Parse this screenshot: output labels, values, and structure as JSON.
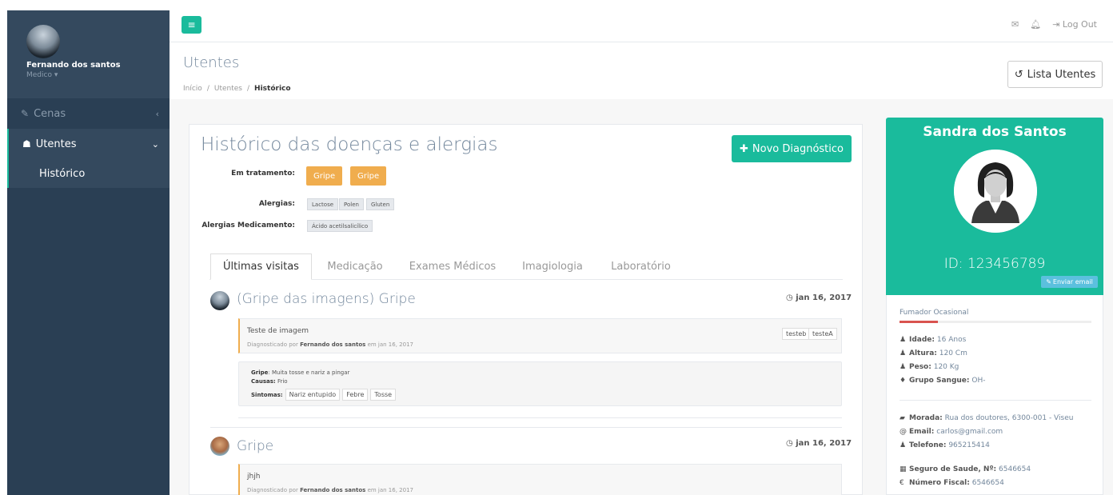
{
  "sidebar": {
    "user_name": "Fernando dos santos",
    "user_role": "Medico",
    "items": [
      {
        "label": "Cenas",
        "icon": "edit-icon"
      },
      {
        "label": "Utentes",
        "icon": "users-icon"
      }
    ],
    "sub_items": [
      {
        "label": "Histórico"
      }
    ]
  },
  "topbar": {
    "menu_icon": "≡",
    "logout_label": "Log Out"
  },
  "header": {
    "title": "Utentes",
    "breadcrumb": [
      "Início",
      "Utentes",
      "Histórico"
    ],
    "lista_button": "Lista Utentes"
  },
  "history": {
    "title": "Histórico das doenças e alergias",
    "novo_button": "Novo Diagnóstico",
    "em_tratamento_label": "Em tratamento:",
    "em_tratamento": [
      "Gripe",
      "Gripe"
    ],
    "alergias_label": "Alergias:",
    "alergias": [
      "Lactose",
      "Polen",
      "Gluten"
    ],
    "alergias_med_label": "Alergias Medicamento:",
    "alergias_med": [
      "Ácido acetilsalicílico"
    ]
  },
  "tabs": [
    "Últimas visitas",
    "Medicação",
    "Exames Médicos",
    "Imagiologia",
    "Laboratório"
  ],
  "visits": [
    {
      "title": "(Gripe das imagens) Gripe",
      "date": "jan 16, 2017",
      "note": "Teste de imagem",
      "by_prefix": "Diagnosticado por",
      "doctor": "Fernando dos santos",
      "by_suffix": "em jan 16, 2017",
      "tags": [
        "testeb",
        "testeA"
      ],
      "gripe_label": "Gripe",
      "gripe_text": ": Muita tosse e nariz a pingar",
      "causas_label": "Causas:",
      "causas_text": "Frio",
      "sintomas_label": "Sintomas:",
      "sintomas": [
        "Nariz entupido",
        "Febre",
        "Tosse"
      ]
    },
    {
      "title": "Gripe",
      "date": "jan 16, 2017",
      "note": "jhjh",
      "by_prefix": "Diagnosticado por",
      "doctor": "Fernando dos santos",
      "by_suffix": "em jan 16, 2017"
    }
  ],
  "patient": {
    "name": "Sandra dos Santos",
    "id_text": "ID: 123456789",
    "email_button": "Enviar email",
    "fumador": "Fumador Ocasional",
    "fumador_level": 0.2,
    "idade_label": "Idade:",
    "idade": "16 Anos",
    "altura_label": "Altura:",
    "altura": "120 Cm",
    "peso_label": "Peso:",
    "peso": "120 Kg",
    "sangue_label": "Grupo Sangue:",
    "sangue": "OH-",
    "morada_label": "Morada:",
    "morada": "Rua dos doutores, 6300-001 - Viseu",
    "email_label": "Email:",
    "email": "carlos@gmail.com",
    "telefone_label": "Telefone:",
    "telefone": "965215414",
    "seguro_label": "Seguro de Saude, Nº:",
    "seguro": "6546654",
    "fiscal_label": "Número Fiscal:",
    "fiscal": "6546654"
  },
  "colors": {
    "accent": "#1abb9c",
    "sidebar": "#2a3f54",
    "orange": "#f0ad4e",
    "danger": "#d9534f"
  }
}
